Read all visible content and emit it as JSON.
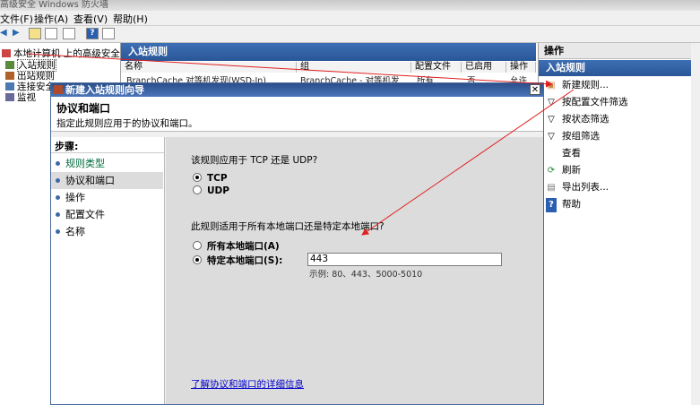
{
  "window_title": "高级安全 Windows 防火墙",
  "menu": [
    "文件(F)",
    "操作(A)",
    "查看(V)",
    "帮助(H)"
  ],
  "tree": {
    "root": "本地计算机 上的高级安全 Win",
    "items": [
      "入站规则",
      "出站规则",
      "连接安全",
      "监视"
    ]
  },
  "center": {
    "header": "入站规则",
    "columns": [
      "名称",
      "组",
      "配置文件",
      "已启用",
      "操作"
    ],
    "row": {
      "name": "BranchCache 对等机发现(WSD-In)",
      "group": "BranchCache - 对等机发",
      "profile": "所有",
      "enabled": "否",
      "action": "允许"
    }
  },
  "actions": {
    "header": "操作",
    "section": "入站规则",
    "items": [
      {
        "label": "新建规则...",
        "icon": "new-rule-icon"
      },
      {
        "label": "按配置文件筛选",
        "icon": "filter-icon"
      },
      {
        "label": "按状态筛选",
        "icon": "filter-icon"
      },
      {
        "label": "按组筛选",
        "icon": "filter-icon"
      },
      {
        "label": "查看",
        "icon": "view-icon"
      },
      {
        "label": "刷新",
        "icon": "refresh-icon"
      },
      {
        "label": "导出列表...",
        "icon": "export-icon"
      },
      {
        "label": "帮助",
        "icon": "help-icon"
      }
    ]
  },
  "dialog": {
    "title": "新建入站规则向导",
    "heading": "协议和端口",
    "subheading": "指定此规则应用于的协议和端口。",
    "steps_title": "步骤:",
    "steps": [
      "规则类型",
      "协议和端口",
      "操作",
      "配置文件",
      "名称"
    ],
    "q1": "该规则应用于 TCP 还是 UDP?",
    "tcp": "TCP",
    "udp": "UDP",
    "q2": "此规则适用于所有本地端口还是特定本地端口?",
    "all_ports": "所有本地端口(A)",
    "specific_ports": "特定本地端口(S):",
    "port_value": "443",
    "example": "示例: 80、443、5000-5010",
    "learn_more": "了解协议和端口的详细信息"
  },
  "colors": {
    "accent": "#2a5697",
    "arrow": "#e02020"
  }
}
